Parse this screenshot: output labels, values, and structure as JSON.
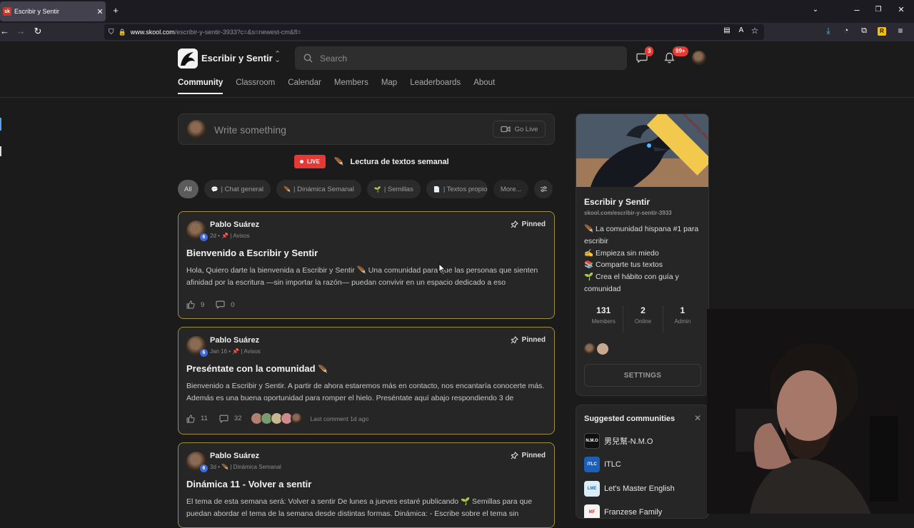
{
  "browser": {
    "tab_title": "Escribir y Sentir",
    "tab_favicon": "sk",
    "url_host": "www.skool.com",
    "url_path": "/escribir-y-sentir-3933?c=&s=newest-cm&fl="
  },
  "header": {
    "group_name": "Escribir y Sentir",
    "search_placeholder": "Search",
    "chat_count": "3",
    "notif_count": "99+",
    "tabs": [
      "Community",
      "Classroom",
      "Calendar",
      "Members",
      "Map",
      "Leaderboards",
      "About"
    ]
  },
  "composer": {
    "placeholder": "Write something",
    "golive_label": "Go Live"
  },
  "live": {
    "badge": "LIVE",
    "title": "Lectura de textos semanal",
    "emoji": "🪶"
  },
  "chips": [
    {
      "label": "All",
      "emoji": ""
    },
    {
      "label": "| Chat general",
      "emoji": "💬"
    },
    {
      "label": "| Dinámica Semanal",
      "emoji": "🪶"
    },
    {
      "label": "| Semillas",
      "emoji": "🌱"
    },
    {
      "label": "| Textos propio",
      "emoji": "📄"
    },
    {
      "label": "More...",
      "emoji": ""
    }
  ],
  "posts": [
    {
      "author": "Pablo Suárez",
      "level": "6",
      "time": "2d",
      "category": "| Avisos",
      "category_emoji": "📌",
      "pinned": "Pinned",
      "title": "Bienvenido a Escribir y Sentir",
      "title_emoji": "",
      "body": "Hola, Quiero darte la bienvenida a Escribir y Sentir 🪶 Una comunidad para que las personas que sienten afinidad por la escritura —sin importar la razón— puedan convivir en un espacio dedicado a eso",
      "likes": "9",
      "comments": "0",
      "last_comment": ""
    },
    {
      "author": "Pablo Suárez",
      "level": "6",
      "time": "Jan 16",
      "category": "| Avisos",
      "category_emoji": "📌",
      "pinned": "Pinned",
      "title": "Preséntate con la comunidad",
      "title_emoji": "🪶",
      "body": "Bienvenido a Escribir y Sentir. A partir de ahora estaremos más en contacto, nos encantaría conocerte más. Además es una buena oportunidad para romper el hielo. Preséntate aquí abajo respondiendo 3 de",
      "likes": "11",
      "comments": "32",
      "last_comment": "Last comment 1d ago"
    },
    {
      "author": "Pablo Suárez",
      "level": "6",
      "time": "3d",
      "category": "| Dinámica Semanal",
      "category_emoji": "🪶",
      "pinned": "Pinned",
      "title": "Dinámica 11 - Volver a sentir",
      "title_emoji": "",
      "body": "El tema de esta semana será: Volver a sentir De lunes a jueves estaré publicando 🌱 Semillas para que puedan abordar el tema de la semana desde distintas formas. Dinámica: - Escribe sobre el tema sin",
      "likes": "",
      "comments": "",
      "last_comment": ""
    }
  ],
  "sidebar": {
    "cover_badge": "Powered by skool",
    "group_name": "Escribir y Sentir",
    "group_url": "skool.com/escribir-y-sentir-3933",
    "description": [
      "🪶 La comunidad hispana #1 para escribir",
      "✍️ Empieza sin miedo",
      "📚 Comparte tus textos",
      "🌱 Crea el hábito con guía y comunidad"
    ],
    "stats": [
      {
        "value": "131",
        "label": "Members"
      },
      {
        "value": "2",
        "label": "Online"
      },
      {
        "value": "1",
        "label": "Admin"
      }
    ],
    "settings_label": "SETTINGS"
  },
  "suggested": {
    "heading": "Suggested communities",
    "items": [
      {
        "name": "男兒幫-N.M.O",
        "icon": "N.M.O",
        "bg": "#101010",
        "fg": "#ffffff"
      },
      {
        "name": "ITLC",
        "icon": "iTLC",
        "bg": "#1c5fb8",
        "fg": "#ffffff"
      },
      {
        "name": "Let's Master English",
        "icon": "LME",
        "bg": "#d9eef8",
        "fg": "#2a6fb0"
      },
      {
        "name": "Franzese Family",
        "icon": "MF",
        "bg": "#f4f4f4",
        "fg": "#c0392b"
      }
    ]
  },
  "colors": {
    "accent_gold": "#a28c42",
    "live_red": "#e53935",
    "level_blue": "#3d68d8"
  }
}
